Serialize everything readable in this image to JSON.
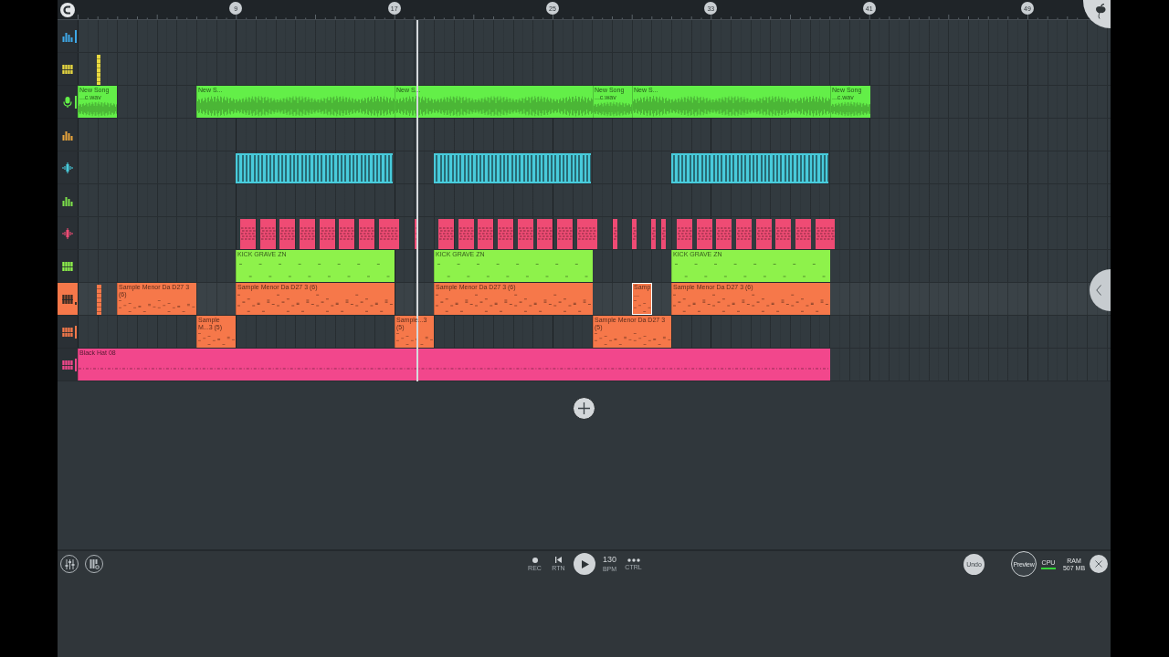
{
  "ruler": {
    "markers": [
      "9",
      "17",
      "25",
      "33",
      "41",
      "49"
    ]
  },
  "tracks": [
    {
      "kind": "bars",
      "color": "#3ea8e8",
      "active": true,
      "selected": false
    },
    {
      "kind": "keys",
      "color": "#e8d840",
      "active": false,
      "selected": false,
      "clips": [
        {
          "kind": "marker",
          "selected": false
        }
      ]
    },
    {
      "kind": "mic",
      "color": "#63ef48",
      "active": true,
      "selected": false,
      "clips": [
        {
          "kind": "audio",
          "label": "New Song ...c.wav",
          "selected": false
        },
        {
          "kind": "audio",
          "label": "New S...",
          "selected": false
        },
        {
          "kind": "audio",
          "label": "New S...",
          "selected": false
        },
        {
          "kind": "audio",
          "label": "New Song ...c.wav",
          "selected": false
        },
        {
          "kind": "audio",
          "label": "New S...",
          "selected": false
        },
        {
          "kind": "audio",
          "label": "New Song ...c.wav",
          "selected": false
        }
      ]
    },
    {
      "kind": "bars",
      "color": "#eaa53c",
      "active": false,
      "selected": false
    },
    {
      "kind": "wave",
      "color": "#48cbdb",
      "active": false,
      "selected": false,
      "clips": [
        {
          "kind": "stripes",
          "selected": false
        },
        {
          "kind": "stripes",
          "selected": false
        },
        {
          "kind": "stripes",
          "selected": false
        }
      ]
    },
    {
      "kind": "bars",
      "color": "#7de24b",
      "active": false,
      "selected": false
    },
    {
      "kind": "wave",
      "color": "#ef4b74",
      "active": false,
      "selected": false,
      "clips": [
        {
          "kind": "hit",
          "selected": false
        },
        {
          "kind": "hit",
          "selected": false
        },
        {
          "kind": "hit",
          "selected": false
        },
        {
          "kind": "hit",
          "selected": false
        },
        {
          "kind": "hit",
          "selected": false
        },
        {
          "kind": "hit",
          "selected": false
        },
        {
          "kind": "hit",
          "selected": false
        },
        {
          "kind": "hit",
          "selected": false
        },
        {
          "kind": "hit",
          "selected": false
        },
        {
          "kind": "hit",
          "selected": false
        },
        {
          "kind": "hit",
          "selected": false
        },
        {
          "kind": "hit",
          "selected": false
        },
        {
          "kind": "hit",
          "selected": false
        },
        {
          "kind": "hit",
          "selected": false
        },
        {
          "kind": "hit",
          "selected": false
        },
        {
          "kind": "hit",
          "selected": false
        },
        {
          "kind": "hit",
          "selected": false
        },
        {
          "kind": "hit",
          "selected": false
        },
        {
          "kind": "hit",
          "selected": false
        },
        {
          "kind": "hit",
          "selected": false
        },
        {
          "kind": "hit",
          "selected": false
        },
        {
          "kind": "hit",
          "selected": false
        },
        {
          "kind": "hit",
          "selected": false
        },
        {
          "kind": "hit",
          "selected": false
        },
        {
          "kind": "hit",
          "selected": false
        },
        {
          "kind": "hit",
          "selected": false
        },
        {
          "kind": "hit",
          "selected": false
        },
        {
          "kind": "hit",
          "selected": false
        },
        {
          "kind": "hit",
          "selected": false
        }
      ]
    },
    {
      "kind": "keys",
      "color": "#8ef24b",
      "active": false,
      "selected": false,
      "clips": [
        {
          "kind": "pattern",
          "label": "KICK GRAVE ZN",
          "selected": false
        },
        {
          "kind": "pattern",
          "label": "KICK GRAVE ZN",
          "selected": false
        },
        {
          "kind": "pattern",
          "label": "KICK GRAVE ZN",
          "selected": false
        }
      ]
    },
    {
      "kind": "keys",
      "color": "#f6784a",
      "active": true,
      "selected": true,
      "clips": [
        {
          "kind": "marker",
          "selected": false
        },
        {
          "kind": "pattern",
          "label": "Sample Menor Da D27 3 (6)",
          "selected": false
        },
        {
          "kind": "pattern",
          "label": "Sample Menor Da D27 3 (6)",
          "selected": false
        },
        {
          "kind": "pattern",
          "label": "Sample Menor Da D27 3 (6)",
          "selected": false
        },
        {
          "kind": "pattern",
          "label": "Samp...",
          "selected": true
        },
        {
          "kind": "pattern",
          "label": "Sample Menor Da D27 3 (6)",
          "selected": false
        }
      ]
    },
    {
      "kind": "keys",
      "color": "#f6784a",
      "active": true,
      "selected": false,
      "clips": [
        {
          "kind": "pattern",
          "label": "Sample M...3 (5)",
          "selected": false
        },
        {
          "kind": "pattern",
          "label": "Sample...3 (5)",
          "selected": false
        },
        {
          "kind": "pattern",
          "label": "Sample Menor Da D27 3 (5)",
          "selected": false
        }
      ]
    },
    {
      "kind": "keys",
      "color": "#f2478c",
      "active": true,
      "selected": false,
      "clips": [
        {
          "kind": "pattern",
          "label": "Black Hat 08",
          "selected": false
        }
      ]
    }
  ],
  "transport": {
    "record": "REC",
    "rewind": "RTN",
    "tempo": {
      "value": "130",
      "label": "BPM"
    },
    "more": "CTRL",
    "undo": "Undo",
    "preview": "Preview",
    "cpu": {
      "label": "CPU",
      "level": 1
    },
    "ram": {
      "label": "RAM",
      "value": "507 MB"
    }
  }
}
